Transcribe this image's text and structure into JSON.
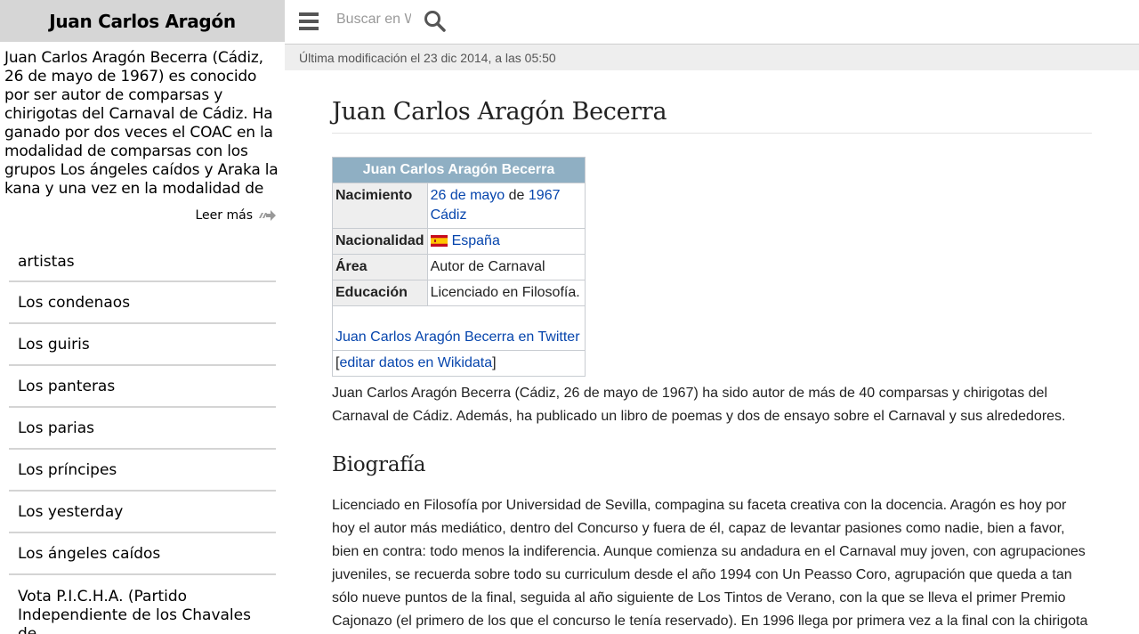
{
  "sidebar": {
    "header_title": "Juan Carlos Aragón",
    "summary": "Juan Carlos Aragón Becerra (Cádiz, 26 de mayo de 1967) es conocido por ser autor de comparsas y chirigotas del Carnaval de Cádiz. Ha ganado por dos veces el COAC en la modalidad de comparsas con los grupos Los ángeles caídos y Araka la kana y una vez en la modalidad de chirigotas con Los",
    "read_more": "Leer más",
    "items": [
      {
        "label": "artistas"
      },
      {
        "label": "Los condenaos"
      },
      {
        "label": "Los guiris"
      },
      {
        "label": "Los panteras"
      },
      {
        "label": "Los parias"
      },
      {
        "label": "Los príncipes"
      },
      {
        "label": "Los yesterday"
      },
      {
        "label": "Los ángeles caídos"
      },
      {
        "label": "Vota P.I.C.H.A. (Partido Independiente de los Chavales de"
      }
    ]
  },
  "topbar": {
    "search_placeholder": "Buscar en Wikipedia",
    "menu_icon": "hamburger-menu-icon",
    "search_icon": "magnifier-icon"
  },
  "last_modified": "Última modificación el 23 dic 2014, a las 05:50",
  "article": {
    "title": "Juan Carlos Aragón Becerra",
    "infobox": {
      "title": "Juan Carlos Aragón Becerra",
      "nacimiento_label": "Nacimiento",
      "nacimiento_day": "26 de mayo",
      "nacimiento_de": "de",
      "nacimiento_year": "1967",
      "nacimiento_place": "Cádiz",
      "nacionalidad_label": "Nacionalidad",
      "nacionalidad_value": "España",
      "area_label": "Área",
      "area_value": "Autor de Carnaval",
      "educacion_label": "Educación",
      "educacion_value": "Licenciado en Filosofía.",
      "twitter_link": "Juan Carlos Aragón Becerra en Twitter",
      "bracket_open": "[",
      "wikidata_link": "editar datos en Wikidata",
      "bracket_close": "]"
    },
    "intro": "Juan Carlos Aragón Becerra (Cádiz, 26 de mayo de 1967) ha sido autor de más de 40 comparsas y chirigotas del Carnaval de Cádiz. Además, ha publicado un libro de poemas y dos de ensayo sobre el Carnaval y sus alrededores.",
    "biografia_heading": "Biografía",
    "biografia_text": "Licenciado en Filosofía por Universidad de Sevilla, compagina su faceta creativa con la docencia. Aragón es hoy por hoy el autor más mediático, dentro del Concurso y fuera de él, capaz de levantar pasiones como nadie, bien a favor, bien en contra: todo menos la indiferencia. Aunque comienza su andadura en el Carnaval muy joven, con agrupaciones juveniles, se recuerda sobre todo su curriculum desde el año 1994 con Un Peasso Coro, agrupación que queda a tan sólo nueve puntos de la final, seguida al año siguiente de Los Tintos de Verano, con la que se lleva el primer Premio Cajonazo (el primero de los que el concurso le tenía reservado). En 1996 llega por primera vez a la final con la chirigota"
  },
  "colors": {
    "link": "#0645ad",
    "infobox_header": "#8fafc3",
    "sidebar_header": "#d6d6d6",
    "lastmod_bar": "#eeeeee"
  }
}
